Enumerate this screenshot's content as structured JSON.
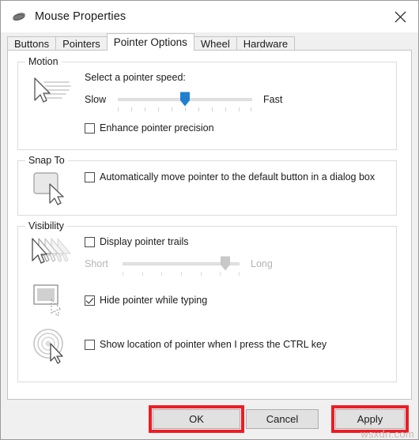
{
  "window": {
    "title": "Mouse Properties",
    "icon": "mouse-icon",
    "close_label": "✕"
  },
  "tabs": [
    {
      "label": "Buttons",
      "active": false
    },
    {
      "label": "Pointers",
      "active": false
    },
    {
      "label": "Pointer Options",
      "active": true
    },
    {
      "label": "Wheel",
      "active": false
    },
    {
      "label": "Hardware",
      "active": false
    }
  ],
  "motion": {
    "group_title": "Motion",
    "icon": "pointer-speed-icon",
    "prompt": "Select a pointer speed:",
    "slider": {
      "low_label": "Slow",
      "high_label": "Fast",
      "value_percent": 50,
      "tick_count": 11,
      "enabled": true,
      "thumb_color": "#1f7fd0"
    },
    "enhance_precision": {
      "label": "Enhance pointer precision",
      "checked": false
    }
  },
  "snap_to": {
    "group_title": "Snap To",
    "icon": "snap-to-default-button-icon",
    "auto_move": {
      "label": "Automatically move pointer to the default button in a dialog box",
      "checked": false
    }
  },
  "visibility": {
    "group_title": "Visibility",
    "trails": {
      "icon": "pointer-trails-icon",
      "label": "Display pointer trails",
      "checked": false,
      "slider": {
        "low_label": "Short",
        "high_label": "Long",
        "value_percent": 88,
        "tick_count": 7,
        "enabled": false,
        "thumb_color": "#c8c8c8"
      }
    },
    "hide_typing": {
      "icon": "hide-pointer-while-typing-icon",
      "label": "Hide pointer while typing",
      "checked": true
    },
    "ctrl_locate": {
      "icon": "show-pointer-location-icon",
      "label": "Show location of pointer when I press the CTRL key",
      "checked": false
    }
  },
  "buttons": {
    "ok": "OK",
    "cancel": "Cancel",
    "apply": "Apply"
  },
  "annotations": {
    "highlight_color": "#ed1c24",
    "watermark": "wsxdn.com"
  }
}
